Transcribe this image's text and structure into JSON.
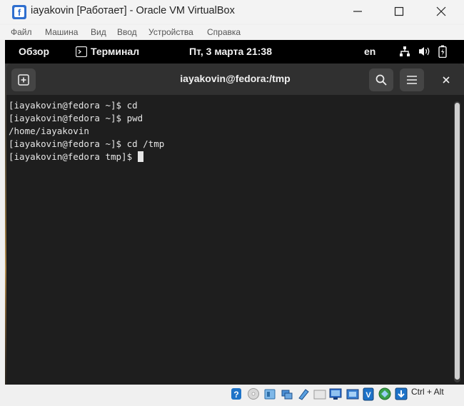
{
  "window": {
    "title": "iayakovin [Работает] - Oracle VM VirtualBox",
    "controls": [
      "minimize",
      "maximize",
      "close"
    ]
  },
  "menu": [
    "Файл",
    "Машина",
    "Вид",
    "Ввод",
    "Устройства",
    "Справка"
  ],
  "gnome_topbar": {
    "activities": "Обзор",
    "app_name": "Терминал",
    "clock": "Пт, 3 марта  21:38",
    "keyboard_layout": "en"
  },
  "terminal": {
    "title": "iayakovin@fedora:/tmp",
    "lines": [
      "[iayakovin@fedora ~]$ cd",
      "[iayakovin@fedora ~]$ pwd",
      "/home/iayakovin",
      "[iayakovin@fedora ~]$ cd /tmp",
      "[iayakovin@fedora tmp]$ "
    ]
  },
  "statusbar": {
    "host_key": "Ctrl + Alt",
    "icons": [
      "hdd-icon",
      "optical-drive-icon",
      "audio-icon",
      "network-icon",
      "usb-icon",
      "shared-folders-icon",
      "display-icon",
      "video-capture-icon",
      "virtualization-icon",
      "mouse-integration-icon",
      "keyboard-capture-icon"
    ]
  },
  "colors": {
    "terminal_bg": "#1e1e1e",
    "terminal_header": "#303030",
    "topbar": "#000000",
    "accent_blue": "#1e73c8"
  }
}
